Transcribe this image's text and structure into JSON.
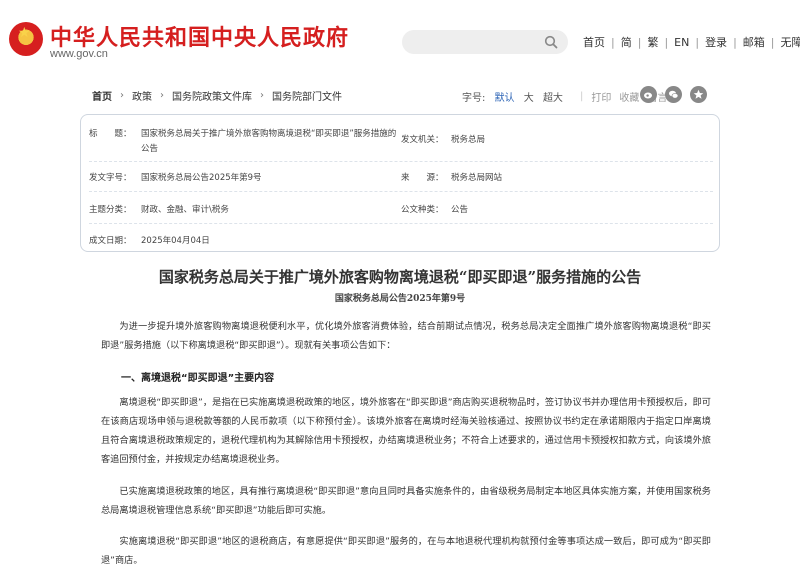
{
  "header": {
    "site_title": "中华人民共和国中央人民政府",
    "site_url": "www.gov.cn",
    "search_placeholder": "",
    "nav": [
      "首页",
      "简",
      "繁",
      "EN",
      "登录",
      "邮箱",
      "无障碍"
    ]
  },
  "breadcrumb": {
    "items": [
      "首页",
      "政策",
      "国务院政策文件库",
      "国务院部门文件"
    ]
  },
  "toolbar": {
    "font_label": "字号:",
    "font_small": "默认",
    "font_large": "大",
    "font_xlarge": "超大",
    "print": "打印",
    "favorite": "收藏",
    "leave": "留言"
  },
  "meta": {
    "title_label": "标　　题：",
    "title_value": "国家税务总局关于推广境外旅客购物离境退税“即买即退”服务措施的公告",
    "issuer_label": "发文机关：",
    "issuer_value": "税务总局",
    "doc_no_label": "发文字号：",
    "doc_no_value": "国家税务总局公告2025年第9号",
    "source_label": "来　　源：",
    "source_value": "税务总局网站",
    "topic_label": "主题分类：",
    "topic_value": "财政、金融、审计\\税务",
    "type_label": "公文种类：",
    "type_value": "公告",
    "date_label": "成文日期：",
    "date_value": "2025年04月04日"
  },
  "article": {
    "title": "国家税务总局关于推广境外旅客购物离境退税“即买即退”服务措施的公告",
    "subtitle": "国家税务总局公告2025年第9号",
    "intro": "为进一步提升境外旅客购物离境退税便利水平，优化境外旅客消费体验，结合前期试点情况，税务总局决定全面推广境外旅客购物离境退税“即买即退”服务措施（以下称离境退税“即买即退”）。现就有关事项公告如下：",
    "section1": "一、离境退税“即买即退”主要内容",
    "p1": "离境退税“即买即退”，是指在已实施离境退税政策的地区，境外旅客在“即买即退”商店购买退税物品时，签订协议书并办理信用卡预授权后，即可在该商店现场申领与退税款等额的人民币款项（以下称预付金）。该境外旅客在离境时经海关验核通过、按照协议书约定在承诺期限内于指定口岸离境且符合离境退税政策规定的，退税代理机构为其解除信用卡预授权，办结离境退税业务；不符合上述要求的，通过信用卡预授权扣款方式，向该境外旅客追回预付金，并按规定办结离境退税业务。",
    "p2": "已实施离境退税政策的地区，具有推行离境退税“即买即退”意向且同时具备实施条件的，由省级税务局制定本地区具体实施方案，并使用国家税务总局离境退税管理信息系统“即买即退”功能后即可实施。",
    "p3": "实施离境退税“即买即退”地区的退税商店，有意愿提供“即买即退”服务的，在与本地退税代理机构就预付金等事项达成一致后，即可成为“即买即退”商店。"
  }
}
